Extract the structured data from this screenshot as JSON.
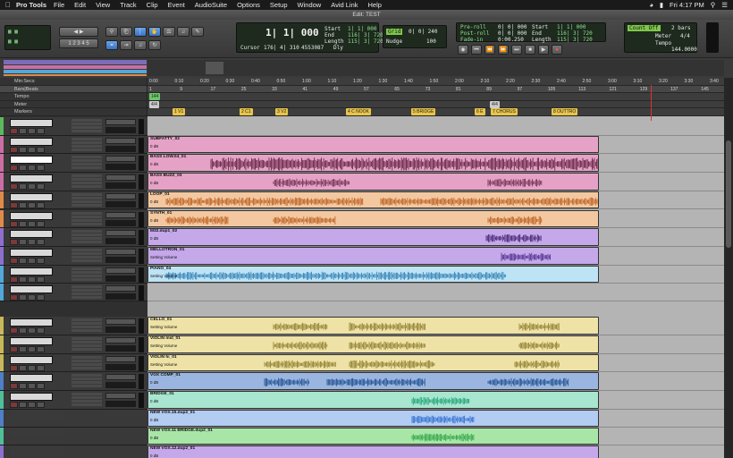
{
  "menubar": {
    "app": "Pro Tools",
    "items": [
      "File",
      "Edit",
      "View",
      "Track",
      "Clip",
      "Event",
      "AudioSuite",
      "Options",
      "Setup",
      "Window",
      "Avid Link",
      "Help"
    ],
    "clock": "Fri 4:17 PM"
  },
  "window": {
    "title": "Edit: TEST"
  },
  "toolbar": {
    "main_counter": "1| 1| 000",
    "cursor_label": "Cursor",
    "cursor_value": "176| 4| 310",
    "sample_value": "4553087",
    "grid_label": "Grid",
    "grid_value": "0| 0| 240",
    "nudge_label": "Nudge",
    "nudge_value": "100",
    "start_label": "Start",
    "start_value": "1| 1| 000",
    "end_label": "End",
    "end_value": "116| 3| 720",
    "length_label": "Length",
    "length_value": "115| 3| 720",
    "preroll_label": "Pre-roll",
    "preroll_value": "0| 0| 000",
    "postroll_label": "Post-roll",
    "postroll_value": "0| 0| 000",
    "fadein_label": "Fade-in",
    "fadein_value": "0:00.250",
    "start2_value": "1| 1| 000",
    "end2_value": "116| 3| 720",
    "length2_value": "115| 3| 720",
    "countoff": "Count Off",
    "bars": "2 bars",
    "meter_label": "Meter",
    "meter_value": "4/4",
    "tempo_label": "Tempo",
    "tempo_value": "144.0000",
    "dly": "Dly"
  },
  "rulers": {
    "labels": [
      "Min:Secs",
      "Bars|Beats",
      "Tempo",
      "Meter",
      "Markers"
    ],
    "minsecs": [
      "0:00",
      "0:10",
      "0:20",
      "0:30",
      "0:40",
      "0:50",
      "1:00",
      "1:10",
      "1:20",
      "1:30",
      "1:40",
      "1:50",
      "2:00",
      "2:10",
      "2:20",
      "2:30",
      "2:40",
      "2:50",
      "3:00",
      "3:10",
      "3:20",
      "3:30",
      "3:40"
    ],
    "bars": [
      "1",
      "9",
      "17",
      "25",
      "33",
      "41",
      "49",
      "57",
      "65",
      "73",
      "81",
      "89",
      "97",
      "105",
      "113",
      "121",
      "129",
      "137",
      "145"
    ],
    "tempo_value": "144",
    "meter_value": "4/4",
    "meter_value2": "4/4",
    "markers": [
      "1 V1",
      "2 C1",
      "3 V2",
      "4 C NOOK",
      "5 BRIDGE",
      "6 E",
      "7 CHORUS",
      "8 OUTTRO"
    ]
  },
  "tracks": [
    {
      "name": "KDRUMS",
      "io": "3:N 2/33",
      "vol": "-4.5",
      "color": "#5cb85c",
      "clip_color": "#bdbdbd",
      "clip_label": "",
      "clip_db": "",
      "wave": "none"
    },
    {
      "name": "SUBFATTY",
      "io": "MGL3 22B",
      "vol": "-0.7",
      "color": "#c96fa6",
      "clip_color": "#e6a2c6",
      "clip_label": "SUBFATTY_02",
      "clip_db": "0 dB",
      "wave": "none"
    },
    {
      "name": "BASS",
      "io": "MGL3 ALBA",
      "vol": "-7.3",
      "color": "#c96fa6",
      "clip_color": "#e6a2c6",
      "clip_label": "BASS LOW.04_01",
      "clip_db": "0 dB",
      "wave": "bass",
      "selected": true
    },
    {
      "name": "BASS BUZZ",
      "io": "MGL3 ALBA",
      "vol": "-11.5",
      "color": "#c96fa6",
      "clip_color": "#e6a2c6",
      "clip_label": "BASS BUZZ_03",
      "clip_db": "0 dB",
      "wave": "buzz"
    },
    {
      "name": "LOOP",
      "io": "MGL3 2/20",
      "vol": "-1.1",
      "color": "#e08a4a",
      "clip_color": "#f3c8a0",
      "clip_label": "LOOP_01",
      "clip_db": "0 dB",
      "wave": "loop"
    },
    {
      "name": "SYNTH",
      "io": "MGL3 2/20",
      "vol": "-2.0",
      "color": "#e08a4a",
      "clip_color": "#f3c8a0",
      "clip_label": "SYNTH_01",
      "clip_db": "0 dB",
      "wave": "synth"
    },
    {
      "name": "M32.dup1",
      "io": "MGL3 2/20",
      "vol": "-4.7",
      "color": "#8e6fcf",
      "clip_color": "#c4a8ea",
      "clip_label": "M32.dup1_02",
      "clip_db": "0 dB",
      "wave": "m32"
    },
    {
      "name": "MELLOTRON",
      "io": "MGL3 1/2",
      "vol": "+0.4",
      "color": "#8e6fcf",
      "clip_color": "#c4a8ea",
      "clip_label": "MELLOTRON_01",
      "clip_db": "Setting Volume",
      "wave": "mell"
    },
    {
      "name": "PIANO",
      "io": "MGL3 1/2",
      "vol": "-2.0",
      "color": "#52a8d8",
      "clip_color": "#bde3f5",
      "clip_label": "PIANO_04",
      "clip_db": "Setting Volume",
      "wave": "piano"
    },
    {
      "name": "sKEYS",
      "io": "Ss2/20 ALB2",
      "vol": "+0.7",
      "color": "#52a8d8",
      "clip_color": "#c8c8c8",
      "clip_label": "",
      "clip_db": "",
      "wave": "none",
      "gap": true
    },
    {
      "name": "CELLO",
      "io": "MGL3 ALAT",
      "vol": "-4.9",
      "color": "#c8b85a",
      "clip_color": "#eee2a6",
      "clip_label": "CELLO_01",
      "clip_db": "Setting Volume",
      "wave": "strings"
    },
    {
      "name": "VIOLIN mid",
      "io": "MGL3 ALAT",
      "vol": "-8.1",
      "color": "#c8b85a",
      "clip_color": "#eee2a6",
      "clip_label": "VIOLIN mid_01",
      "clip_db": "Setting Volume",
      "wave": "strings"
    },
    {
      "name": "VIOLIN hi",
      "io": "MGL3 ALAT",
      "vol": "-8.1",
      "color": "#c8b85a",
      "clip_color": "#eee2a6",
      "clip_label": "VIOLIN hi_01",
      "clip_db": "Setting Volume",
      "wave": "strings2"
    },
    {
      "name": "VOX COMP",
      "io": "MGL3 ALAT",
      "vol": "-2.0",
      "color": "#4f7fc7",
      "clip_color": "#9ab6e0",
      "clip_label": "VOX COMP_01",
      "clip_db": "0 dB",
      "wave": "vox"
    },
    {
      "name": "BRIDGE",
      "io": "MGL3 ALAT",
      "vol": "+0.0",
      "color": "#4fbf9a",
      "clip_color": "#a8e6d0",
      "clip_label": "BRIDGE_01",
      "clip_db": "0 dB",
      "wave": "bridge"
    },
    {
      "name": "NEW VOX.15.dup2",
      "io": "",
      "vol": "",
      "color": "#4f7fc7",
      "clip_color": "#b2ccf2",
      "clip_label": "NEW VOX.15.dup2_01",
      "clip_db": "0 dB",
      "wave": "nv15",
      "sub": true
    },
    {
      "name": "NEWVOX11BRIDG2",
      "io": "",
      "vol": "",
      "color": "#4fbf9a",
      "clip_color": "#a8e6a8",
      "clip_label": "NEW VOX.11 BRIDGE.dup2_01",
      "clip_db": "0 dB",
      "wave": "nv11",
      "sub": true
    },
    {
      "name": "NEW VOX.12.dup2",
      "io": "",
      "vol": "",
      "color": "#8e6fcf",
      "clip_color": "#c4a8ea",
      "clip_label": "NEW VOX.12.dup2_01",
      "clip_db": "0 dB",
      "wave": "none",
      "sub": true
    }
  ]
}
